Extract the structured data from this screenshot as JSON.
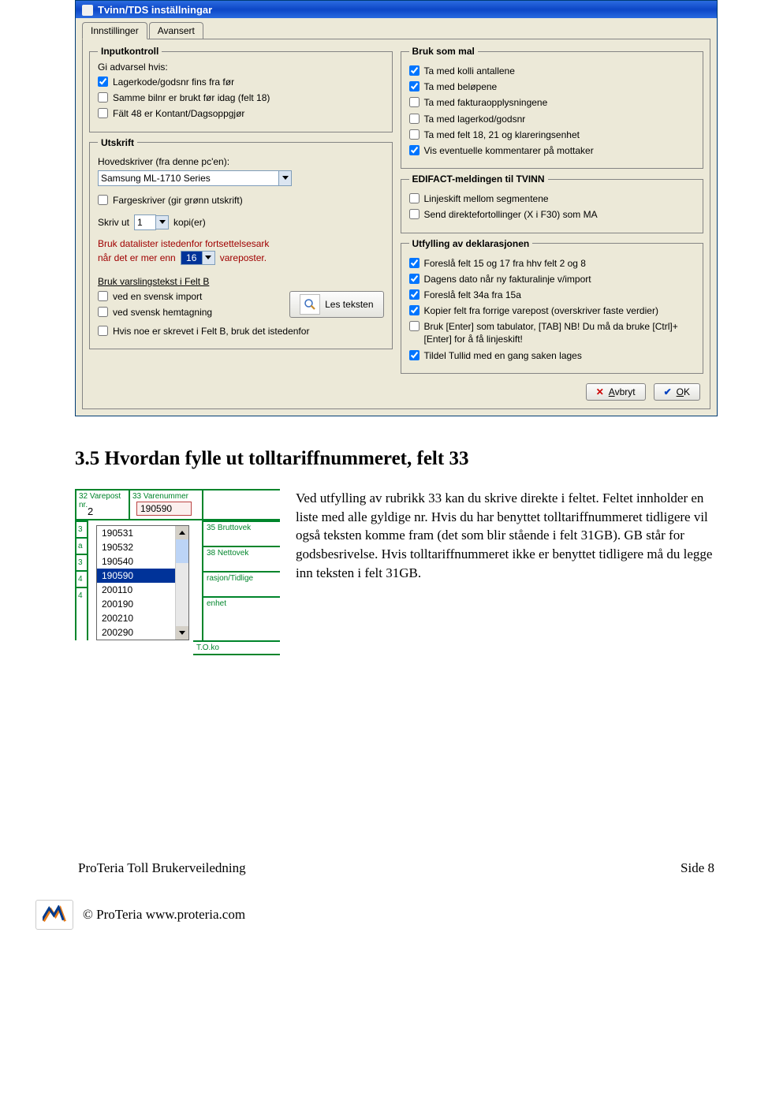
{
  "dialog": {
    "title": "Tvinn/TDS inställningar",
    "tabs": {
      "t1": "Innstillinger",
      "t2": "Avansert"
    },
    "inputkontroll": {
      "legend": "Inputkontroll",
      "intro": "Gi advarsel hvis:",
      "c1": "Lagerkode/godsnr fins fra før",
      "c2": "Samme bilnr er brukt før idag (felt 18)",
      "c3": "Fält 48 er Kontant/Dagsoppgjør"
    },
    "bruk_mal": {
      "legend": "Bruk som mal",
      "c1": "Ta med kolli antallene",
      "c2": "Ta med beløpene",
      "c3": "Ta med fakturaopplysningene",
      "c4": "Ta med lagerkod/godsnr",
      "c5": "Ta med felt 18, 21 og klareringsenhet",
      "c6": "Vis eventuelle kommentarer på mottaker"
    },
    "utskrift": {
      "legend": "Utskrift",
      "printer_label": "Hovedskriver (fra denne pc'en):",
      "printer_value": "Samsung ML-1710 Series",
      "farge": "Fargeskriver (gir grønn utskrift)",
      "skriv_ut": "Skriv ut",
      "kopi_value": "1",
      "kopier": "kopi(er)",
      "data1": "Bruk datalister istedenfor fortsettelsesark",
      "data2a": "når det er mer enn",
      "data2_val": "16",
      "data2b": "vareposter.",
      "varsel_head": "Bruk varslingstekst i Felt B",
      "v1": "ved en svensk import",
      "v2": "ved svensk hemtagning",
      "les": "Les teksten",
      "v3": "Hvis noe er skrevet i Felt B, bruk det istedenfor"
    },
    "edifact": {
      "legend": "EDIFACT-meldingen til TVINN",
      "c1": "Linjeskift mellom segmentene",
      "c2": "Send direktefortollinger (X i F30) som MA"
    },
    "utfylling": {
      "legend": "Utfylling av deklarasjonen",
      "c1": "Foreslå felt 15 og 17 fra hhv felt 2 og 8",
      "c2": "Dagens dato når ny fakturalinje v/import",
      "c3": "Foreslå felt 34a fra 15a",
      "c4": "Kopier felt fra forrige varepost (overskriver faste verdier)",
      "c5": "Bruk [Enter] som tabulator, [TAB] NB! Du må da bruke [Ctrl]+[Enter] for å få linjeskift!",
      "c6": "Tildel Tullid med en gang saken lages"
    },
    "buttons": {
      "cancel": "Avbryt",
      "ok": "OK"
    }
  },
  "section": {
    "heading": "3.5   Hvordan fylle ut tolltariffnummeret, felt 33",
    "body": "Ved utfylling av rubrikk 33 kan du skrive direkte i feltet. Feltet innholder en liste med alle gyldige nr. Hvis du har benyttet tolltariffnummeret tidligere vil også teksten komme fram (det som blir stående i felt 31GB). GB står for godsbesrivelse. Hvis tolltariffnummeret ikke er benyttet tidligere må du legge inn teksten i felt 31GB."
  },
  "form": {
    "h32": "32 Varepost",
    "hnr": "nr.",
    "h33": "33 Varenummer",
    "selected": "190590",
    "two": "2",
    "f35": "35 Bruttovek",
    "f38": "38 Nettovek",
    "frt": "rasjon/Tidlige",
    "enhet": "enhet",
    "items": [
      "190531",
      "190532",
      "190540",
      "190590",
      "200110",
      "200190",
      "200210",
      "200290"
    ],
    "tok": "T.O.ko"
  },
  "footer": {
    "left": "ProTeria Toll  Brukerveiledning",
    "right": "Side 8",
    "copy": "© ProTeria www.proteria.com"
  }
}
